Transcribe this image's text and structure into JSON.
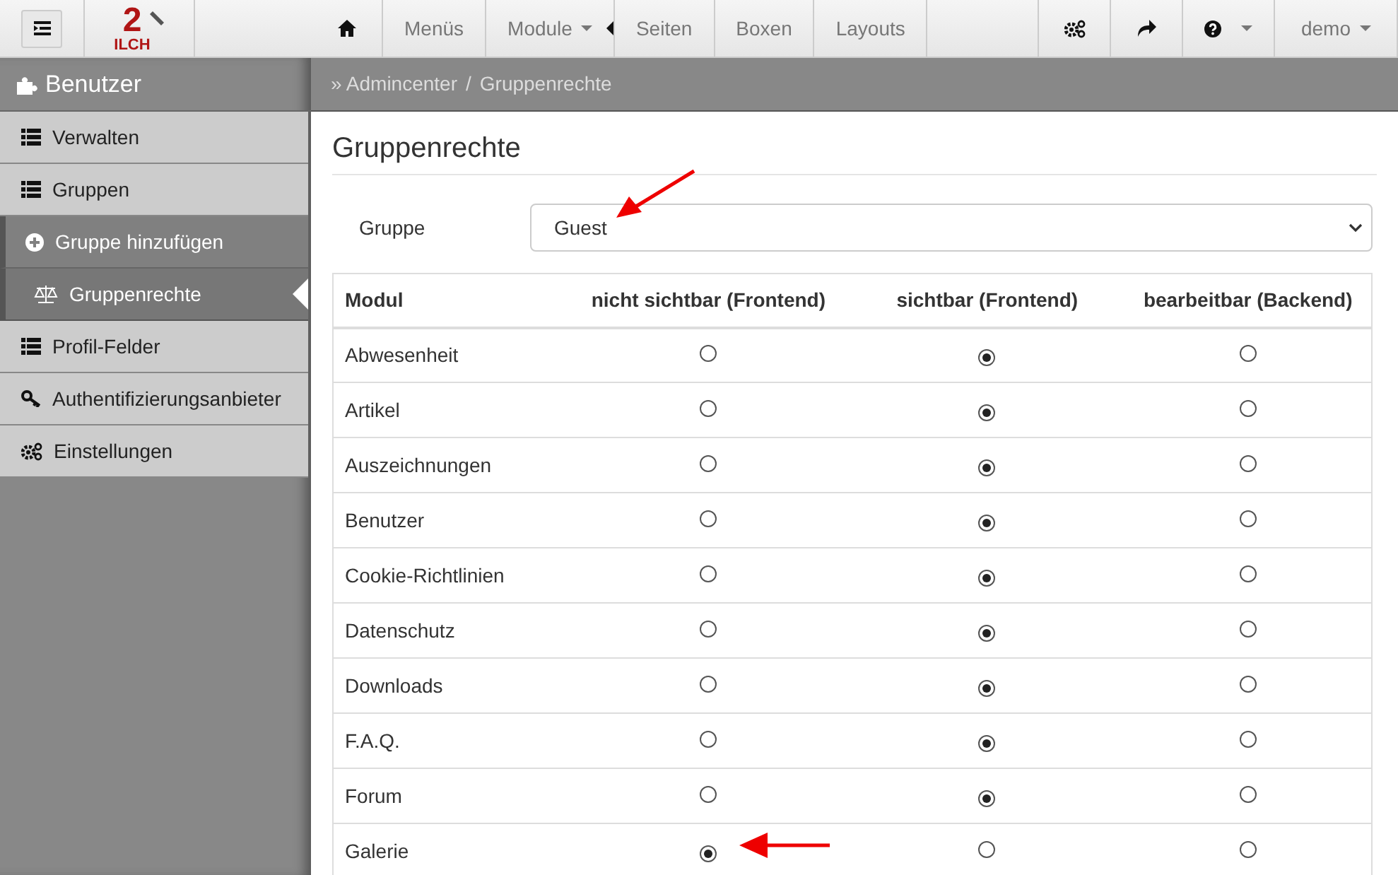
{
  "topnav": {
    "items": [
      {
        "kind": "icon"
      },
      {
        "kind": "text",
        "label": "Menüs"
      },
      {
        "kind": "dropdown",
        "label": "Module"
      },
      {
        "kind": "text",
        "label": "Seiten"
      },
      {
        "kind": "text",
        "label": "Boxen"
      },
      {
        "kind": "text",
        "label": "Layouts"
      }
    ],
    "right": [
      {
        "kind": "icon"
      },
      {
        "kind": "icon"
      },
      {
        "kind": "icondrop"
      },
      {
        "kind": "dropdown",
        "label": "demo"
      }
    ],
    "logo": {
      "number": "2",
      "text": "ILCH"
    }
  },
  "sidebar": {
    "title": "Benutzer",
    "items": [
      {
        "label": "Verwalten",
        "sub": false,
        "selected": false
      },
      {
        "label": "Gruppen",
        "sub": false,
        "selected": false
      },
      {
        "label": "Gruppe hinzufügen",
        "sub": true,
        "selected": false
      },
      {
        "label": "Gruppenrechte",
        "sub": true,
        "selected": true
      },
      {
        "label": "Profil-Felder",
        "sub": false,
        "selected": false
      },
      {
        "label": "Authentifizierungsanbieter",
        "sub": false,
        "selected": false
      },
      {
        "label": "Einstellungen",
        "sub": false,
        "selected": false
      }
    ]
  },
  "breadcrumb": {
    "items": [
      "» Admincenter",
      "Gruppenrechte"
    ],
    "separator": "/"
  },
  "page_title": "Gruppenrechte",
  "group": {
    "label": "Gruppe",
    "value": "Guest"
  },
  "table": {
    "columns": [
      "Modul",
      "nicht sichtbar (Frontend)",
      "sichtbar (Frontend)",
      "bearbeitbar (Backend)"
    ],
    "rows": [
      {
        "module": "Abwesenheit",
        "options": [
          {
            "selected": false
          },
          {
            "selected": true
          },
          {
            "selected": false
          }
        ]
      },
      {
        "module": "Artikel",
        "options": [
          {
            "selected": false
          },
          {
            "selected": true
          },
          {
            "selected": false
          }
        ]
      },
      {
        "module": "Auszeichnungen",
        "options": [
          {
            "selected": false
          },
          {
            "selected": true
          },
          {
            "selected": false
          }
        ]
      },
      {
        "module": "Benutzer",
        "options": [
          {
            "selected": false
          },
          {
            "selected": true
          },
          {
            "selected": false
          }
        ]
      },
      {
        "module": "Cookie-Richtlinien",
        "options": [
          {
            "selected": false
          },
          {
            "selected": true
          },
          {
            "selected": false
          }
        ]
      },
      {
        "module": "Datenschutz",
        "options": [
          {
            "selected": false
          },
          {
            "selected": true
          },
          {
            "selected": false
          }
        ]
      },
      {
        "module": "Downloads",
        "options": [
          {
            "selected": false
          },
          {
            "selected": true
          },
          {
            "selected": false
          }
        ]
      },
      {
        "module": "F.A.Q.",
        "options": [
          {
            "selected": false
          },
          {
            "selected": true
          },
          {
            "selected": false
          }
        ]
      },
      {
        "module": "Forum",
        "options": [
          {
            "selected": false
          },
          {
            "selected": true
          },
          {
            "selected": false
          }
        ]
      },
      {
        "module": "Galerie",
        "options": [
          {
            "selected": true
          },
          {
            "selected": false
          },
          {
            "selected": false
          }
        ]
      }
    ]
  }
}
